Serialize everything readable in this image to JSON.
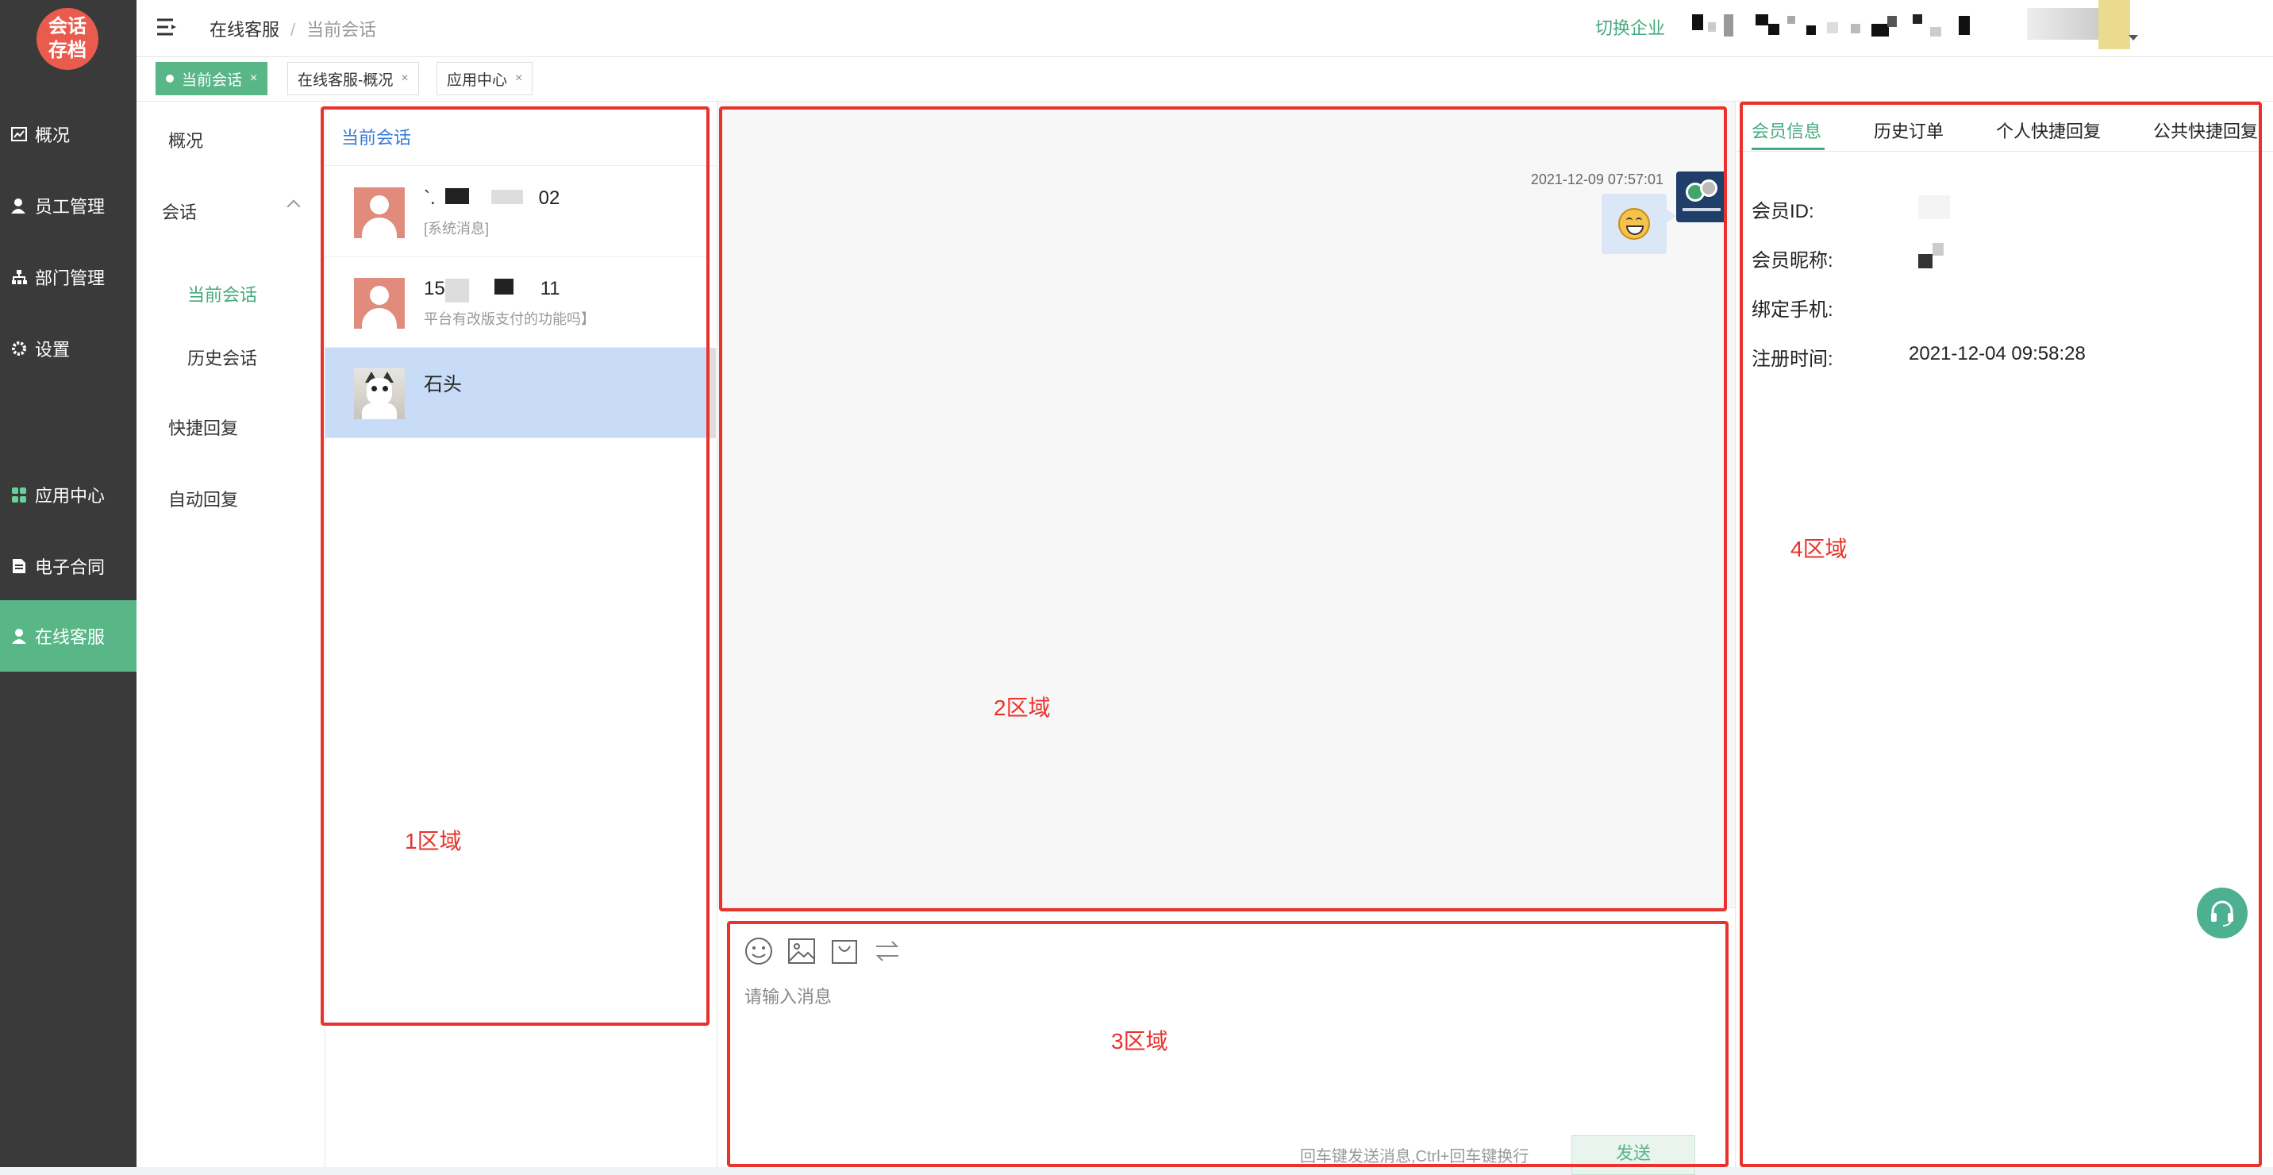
{
  "logo": {
    "line1": "会话",
    "line2": "存档"
  },
  "sidebar": {
    "items": [
      {
        "label": "概况",
        "icon": "chart-icon"
      },
      {
        "label": "员工管理",
        "icon": "person-icon"
      },
      {
        "label": "部门管理",
        "icon": "org-icon"
      },
      {
        "label": "设置",
        "icon": "gear-icon"
      },
      {
        "label": "应用中心",
        "icon": "apps-icon"
      },
      {
        "label": "电子合同",
        "icon": "doc-icon"
      },
      {
        "label": "在线客服",
        "icon": "person-icon"
      }
    ]
  },
  "breadcrumb": {
    "parent": "在线客服",
    "sep": "/",
    "current": "当前会话"
  },
  "header": {
    "switch_label": "切换企业"
  },
  "tabs": [
    {
      "label": "当前会话",
      "close": "×"
    },
    {
      "label": "在线客服-概况",
      "close": "×"
    },
    {
      "label": "应用中心",
      "close": "×"
    }
  ],
  "submenu": {
    "overview": "概况",
    "conversation": "会话",
    "current": "当前会话",
    "history": "历史会话",
    "quick_reply": "快捷回复",
    "auto_reply": "自动回复"
  },
  "conv_list": {
    "title": "当前会话",
    "items": [
      {
        "name_prefix": "`.",
        "name_suffix": "02",
        "message": "[系统消息]"
      },
      {
        "name_prefix": "15",
        "name_suffix": "11",
        "message": "平台有改版支付的功能吗】"
      },
      {
        "name_prefix": "石头",
        "name_suffix": "",
        "message": ""
      }
    ]
  },
  "chat": {
    "timestamp": "2021-12-09 07:57:01"
  },
  "input": {
    "placeholder": "请输入消息",
    "hint": "回车键发送消息,Ctrl+回车键换行",
    "send": "发送"
  },
  "right_panel": {
    "tabs": [
      "会员信息",
      "历史订单",
      "个人快捷回复",
      "公共快捷回复"
    ],
    "fields": [
      {
        "label": "会员ID:",
        "value": ""
      },
      {
        "label": "会员昵称:",
        "value": ""
      },
      {
        "label": "绑定手机:",
        "value": ""
      },
      {
        "label": "注册时间:",
        "value": "2021-12-04 09:58:28"
      }
    ]
  },
  "annotations": {
    "area1": "1区域",
    "area2": "2区域",
    "area3": "3区域",
    "area4": "4区域"
  },
  "colors": {
    "accent": "#58b687",
    "sidebar": "#3a3a3a",
    "highlight": "#e8322b",
    "link": "#3a7bd5"
  }
}
